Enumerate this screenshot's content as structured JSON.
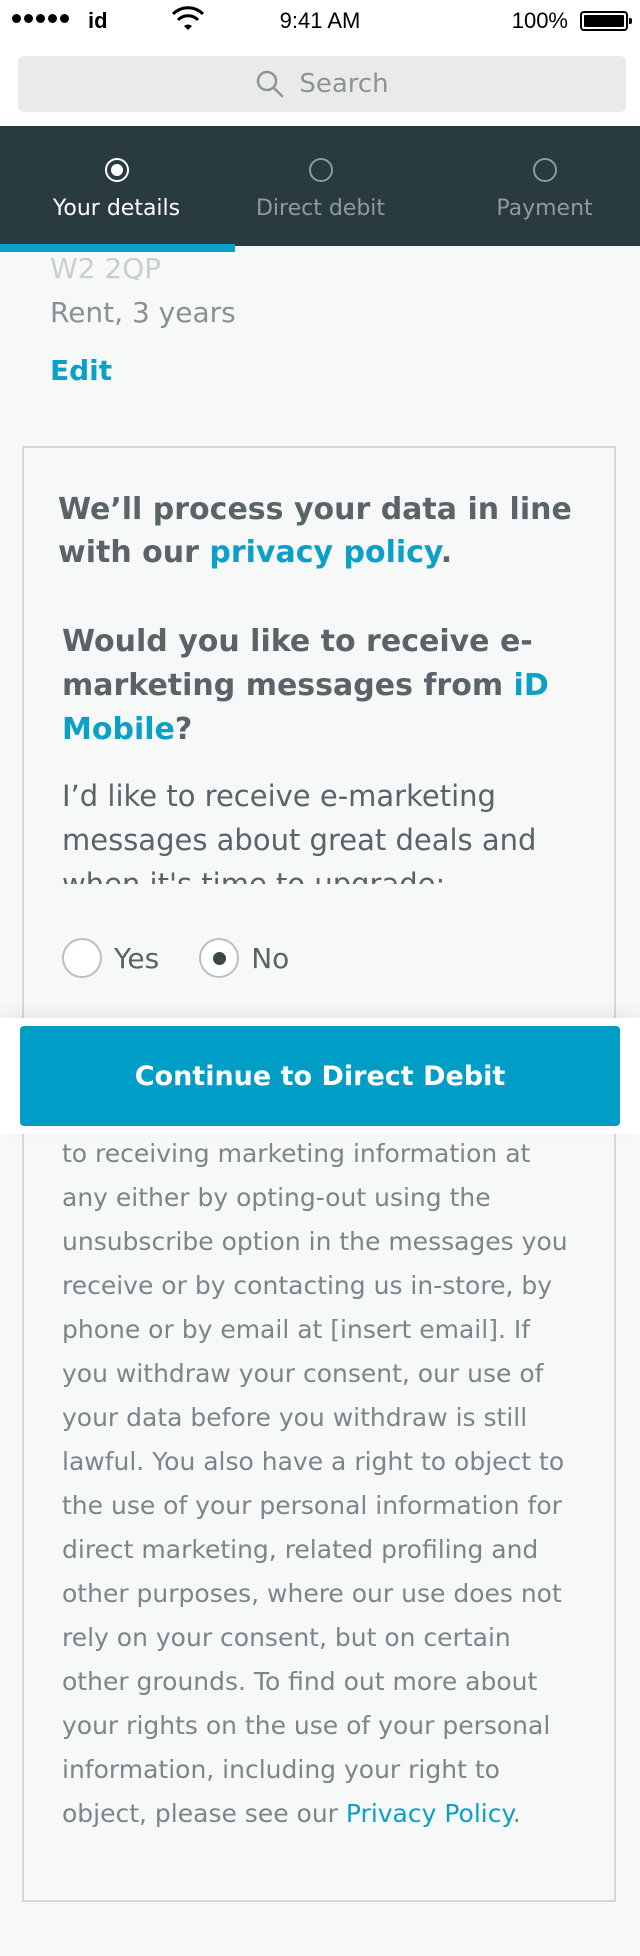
{
  "status_bar": {
    "carrier": "id",
    "time": "9:41 AM",
    "battery": "100%"
  },
  "search": {
    "placeholder": "Search"
  },
  "stepper": {
    "steps": [
      {
        "label": "Your details",
        "state": "active"
      },
      {
        "label": "Direct debit",
        "state": "inactive"
      },
      {
        "label": "Payment",
        "state": "inactive"
      }
    ]
  },
  "address": {
    "postcode": "W2 2QP",
    "tenure": "Rent, 3 years",
    "edit_label": "Edit"
  },
  "card": {
    "privacy_prefix": "We’ll process your data in line with our ",
    "privacy_link": "privacy policy",
    "privacy_suffix": ".",
    "question_prefix": "Would you like to receive e-marketing messages from ",
    "question_brand": "iD Mobile",
    "question_suffix": "?",
    "consent_text": "I’d like to receive e-marketing messages about great deals and when it's time to upgrade:",
    "options": {
      "yes": "Yes",
      "no": "No",
      "selected": "No"
    },
    "legal_text": "to receiving marketing information at any either by opting-out using the unsubscribe option in the messages you receive or by contacting us in-store, by phone or by email at [insert email]. If you withdraw your consent, our use of your data before you withdraw is still lawful. You also have a right to object to the use of your personal information for direct marketing, related profiling and other purposes, where our use does not rely on your consent, but on certain other grounds. To find out more about your rights on the use of your personal information, including your right to object, please see our ",
    "legal_link": "Privacy Policy",
    "legal_suffix": "."
  },
  "cta": {
    "label": "Continue to Direct Debit"
  },
  "colors": {
    "accent": "#0aa0c8",
    "button": "#009ec7",
    "header_bg": "#2a3a41"
  },
  "icons": [
    "signal-icon",
    "wifi-icon",
    "battery-icon",
    "search-icon",
    "radio-icon"
  ]
}
